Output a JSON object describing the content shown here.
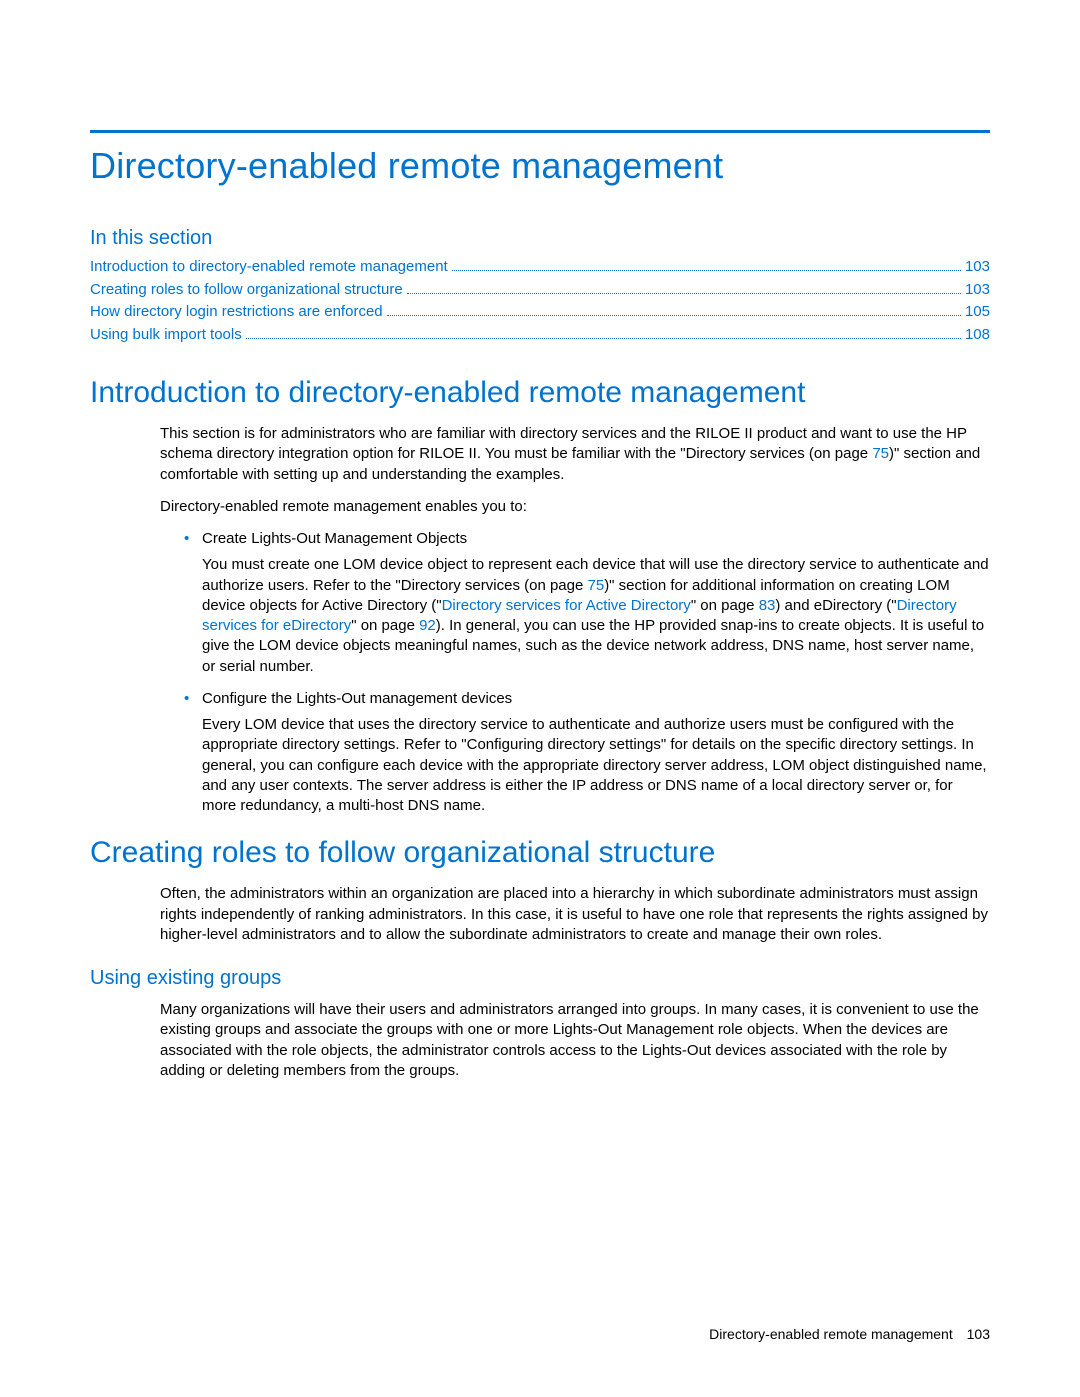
{
  "title": "Directory-enabled remote management",
  "in_this_section_label": "In this section",
  "toc": [
    {
      "label": "Introduction to directory-enabled remote management",
      "page": "103"
    },
    {
      "label": "Creating roles to follow organizational structure",
      "page": "103"
    },
    {
      "label": "How directory login restrictions are enforced",
      "page": "105"
    },
    {
      "label": "Using bulk import tools",
      "page": "108"
    }
  ],
  "sections": {
    "intro": {
      "heading": "Introduction to directory-enabled remote management",
      "p1a": "This section is for administrators who are familiar with directory services and the RILOE II product and want to use the HP schema directory integration option for RILOE II. You must be familiar with the \"Directory services (on page ",
      "p1_link1": "75",
      "p1b": ")\" section and comfortable with setting up and understanding the examples.",
      "p2": "Directory-enabled remote management enables you to:",
      "b1_title": "Create Lights-Out Management Objects",
      "b1a": "You must create one LOM device object to represent each device that will use the directory service to authenticate and authorize users. Refer to the \"Directory services (on page ",
      "b1_link1": "75",
      "b1b": ")\" section for additional information on creating LOM device objects for Active Directory (\"",
      "b1_link2": "Directory services for Active Directory",
      "b1c": "\" on page ",
      "b1_link3": "83",
      "b1d": ") and eDirectory (\"",
      "b1_link4": "Directory services for eDirectory",
      "b1e": "\" on page ",
      "b1_link5": "92",
      "b1f": "). In general, you can use the HP provided snap-ins to create objects. It is useful to give the LOM device objects meaningful names, such as the device network address, DNS name, host server name, or serial number.",
      "b2_title": "Configure the Lights-Out management devices",
      "b2_para": "Every LOM device that uses the directory service to authenticate and authorize users must be configured with the appropriate directory settings. Refer to \"Configuring directory settings\" for details on the specific directory settings. In general, you can configure each device with the appropriate directory server address, LOM object distinguished name, and any user contexts. The server address is either the IP address or DNS name of a local directory server or, for more redundancy, a multi-host DNS name."
    },
    "roles": {
      "heading": "Creating roles to follow organizational structure",
      "p1": "Often, the administrators within an organization are placed into a hierarchy in which subordinate administrators must assign rights independently of ranking administrators. In this case, it is useful to have one role that represents the rights assigned by higher-level administrators and to allow the subordinate administrators to create and manage their own roles.",
      "sub_heading": "Using existing groups",
      "sub_p1": "Many organizations will have their users and administrators arranged into groups. In many cases, it is convenient to use the existing groups and associate the groups with one or more Lights-Out Management role objects. When the devices are associated with the role objects, the administrator controls access to the Lights-Out devices associated with the role by adding or deleting members from the groups."
    }
  },
  "footer": {
    "text": "Directory-enabled remote management",
    "page": "103"
  }
}
